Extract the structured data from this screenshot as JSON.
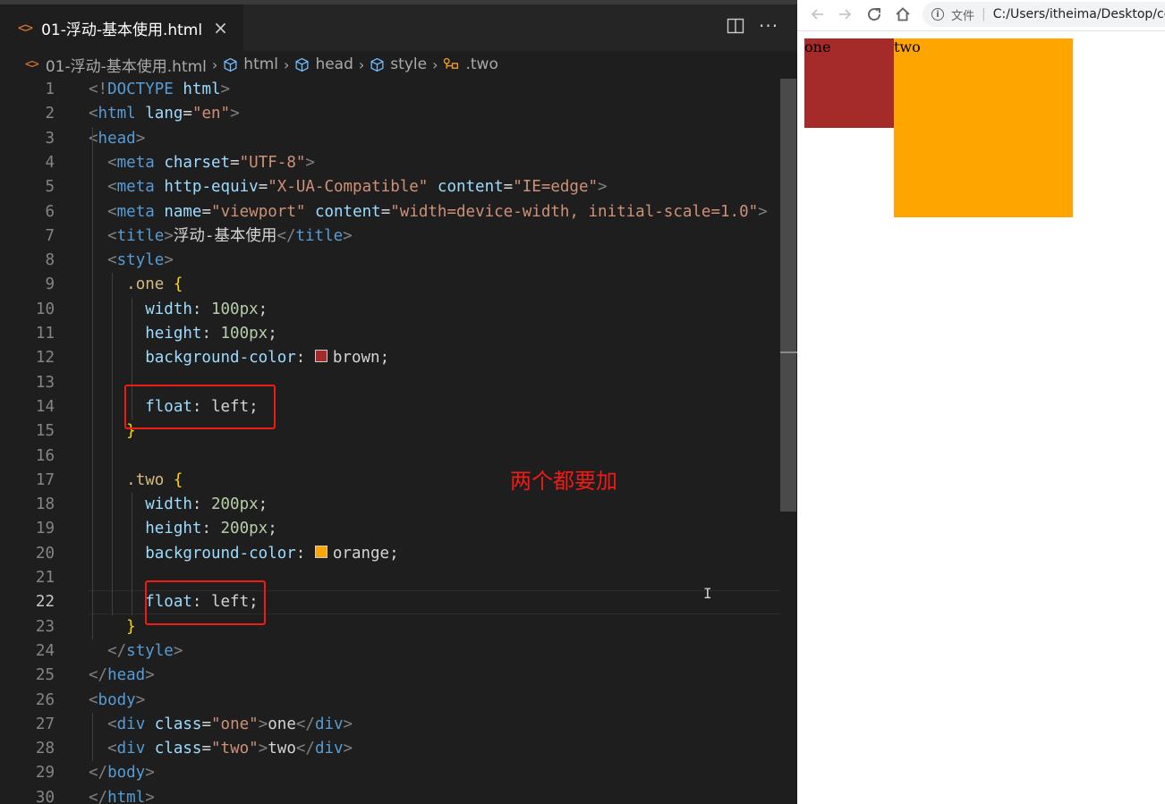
{
  "editor": {
    "tab": {
      "icon": "html-file-icon",
      "label": "01-浮动-基本使用.html",
      "close": "×"
    },
    "actions": {
      "split": "split-editor-icon",
      "more": "···"
    },
    "breadcrumb": {
      "file": "01-浮动-基本使用.html",
      "items": [
        "html",
        "head",
        "style",
        ".two"
      ]
    },
    "lines": [
      {
        "n": "1",
        "tokens": [
          [
            "punc",
            "<!"
          ],
          [
            "tag",
            "DOCTYPE"
          ],
          [
            "text",
            " "
          ],
          [
            "attr",
            "html"
          ],
          [
            "punc",
            ">"
          ]
        ]
      },
      {
        "n": "2",
        "tokens": [
          [
            "punc",
            "<"
          ],
          [
            "tag",
            "html"
          ],
          [
            "text",
            " "
          ],
          [
            "attr",
            "lang"
          ],
          [
            "text",
            "="
          ],
          [
            "str",
            "\"en\""
          ],
          [
            "punc",
            ">"
          ]
        ]
      },
      {
        "n": "3",
        "tokens": [
          [
            "punc",
            "<"
          ],
          [
            "tag",
            "head"
          ],
          [
            "punc",
            ">"
          ]
        ]
      },
      {
        "n": "4",
        "tokens": [
          [
            "text",
            "  "
          ],
          [
            "punc",
            "<"
          ],
          [
            "tag",
            "meta"
          ],
          [
            "text",
            " "
          ],
          [
            "attr",
            "charset"
          ],
          [
            "text",
            "="
          ],
          [
            "str",
            "\"UTF-8\""
          ],
          [
            "punc",
            ">"
          ]
        ]
      },
      {
        "n": "5",
        "tokens": [
          [
            "text",
            "  "
          ],
          [
            "punc",
            "<"
          ],
          [
            "tag",
            "meta"
          ],
          [
            "text",
            " "
          ],
          [
            "attr",
            "http-equiv"
          ],
          [
            "text",
            "="
          ],
          [
            "str",
            "\"X-UA-Compatible\""
          ],
          [
            "text",
            " "
          ],
          [
            "attr",
            "content"
          ],
          [
            "text",
            "="
          ],
          [
            "str",
            "\"IE=edge\""
          ],
          [
            "punc",
            ">"
          ]
        ]
      },
      {
        "n": "6",
        "tokens": [
          [
            "text",
            "  "
          ],
          [
            "punc",
            "<"
          ],
          [
            "tag",
            "meta"
          ],
          [
            "text",
            " "
          ],
          [
            "attr",
            "name"
          ],
          [
            "text",
            "="
          ],
          [
            "str",
            "\"viewport\""
          ],
          [
            "text",
            " "
          ],
          [
            "attr",
            "content"
          ],
          [
            "text",
            "="
          ],
          [
            "str",
            "\"width=device-width, initial-scale=1.0\""
          ],
          [
            "punc",
            ">"
          ]
        ]
      },
      {
        "n": "7",
        "tokens": [
          [
            "text",
            "  "
          ],
          [
            "punc",
            "<"
          ],
          [
            "tag",
            "title"
          ],
          [
            "punc",
            ">"
          ],
          [
            "text",
            "浮动-基本使用"
          ],
          [
            "punc",
            "</"
          ],
          [
            "tag",
            "title"
          ],
          [
            "punc",
            ">"
          ]
        ]
      },
      {
        "n": "8",
        "tokens": [
          [
            "text",
            "  "
          ],
          [
            "punc",
            "<"
          ],
          [
            "tag",
            "style"
          ],
          [
            "punc",
            ">"
          ]
        ]
      },
      {
        "n": "9",
        "tokens": [
          [
            "text",
            "    "
          ],
          [
            "sel",
            ".one"
          ],
          [
            "text",
            " "
          ],
          [
            "brace",
            "{"
          ]
        ]
      },
      {
        "n": "10",
        "tokens": [
          [
            "text",
            "      "
          ],
          [
            "prop",
            "width"
          ],
          [
            "text",
            ": "
          ],
          [
            "num",
            "100px"
          ],
          [
            "text",
            ";"
          ]
        ]
      },
      {
        "n": "11",
        "tokens": [
          [
            "text",
            "      "
          ],
          [
            "prop",
            "height"
          ],
          [
            "text",
            ": "
          ],
          [
            "num",
            "100px"
          ],
          [
            "text",
            ";"
          ]
        ]
      },
      {
        "n": "12",
        "tokens": [
          [
            "text",
            "      "
          ],
          [
            "prop",
            "background-color"
          ],
          [
            "text",
            ": "
          ],
          [
            "swatch",
            "#a52a2a"
          ],
          [
            "val",
            "brown"
          ],
          [
            "text",
            ";"
          ]
        ]
      },
      {
        "n": "13",
        "tokens": []
      },
      {
        "n": "14",
        "tokens": [
          [
            "text",
            "      "
          ],
          [
            "prop",
            "float"
          ],
          [
            "text",
            ": "
          ],
          [
            "val",
            "left"
          ],
          [
            "text",
            ";"
          ]
        ]
      },
      {
        "n": "15",
        "tokens": [
          [
            "text",
            "    "
          ],
          [
            "brace",
            "}"
          ]
        ]
      },
      {
        "n": "16",
        "tokens": []
      },
      {
        "n": "17",
        "tokens": [
          [
            "text",
            "    "
          ],
          [
            "sel",
            ".two"
          ],
          [
            "text",
            " "
          ],
          [
            "brace",
            "{"
          ]
        ]
      },
      {
        "n": "18",
        "tokens": [
          [
            "text",
            "      "
          ],
          [
            "prop",
            "width"
          ],
          [
            "text",
            ": "
          ],
          [
            "num",
            "200px"
          ],
          [
            "text",
            ";"
          ]
        ]
      },
      {
        "n": "19",
        "tokens": [
          [
            "text",
            "      "
          ],
          [
            "prop",
            "height"
          ],
          [
            "text",
            ": "
          ],
          [
            "num",
            "200px"
          ],
          [
            "text",
            ";"
          ]
        ]
      },
      {
        "n": "20",
        "tokens": [
          [
            "text",
            "      "
          ],
          [
            "prop",
            "background-color"
          ],
          [
            "text",
            ": "
          ],
          [
            "swatch",
            "#ffa500"
          ],
          [
            "val",
            "orange"
          ],
          [
            "text",
            ";"
          ]
        ]
      },
      {
        "n": "21",
        "tokens": []
      },
      {
        "n": "22",
        "tokens": [
          [
            "text",
            "      "
          ],
          [
            "prop",
            "float"
          ],
          [
            "text",
            ": "
          ],
          [
            "val",
            "left"
          ],
          [
            "text",
            ";"
          ]
        ]
      },
      {
        "n": "23",
        "tokens": [
          [
            "text",
            "    "
          ],
          [
            "brace",
            "}"
          ]
        ]
      },
      {
        "n": "24",
        "tokens": [
          [
            "text",
            "  "
          ],
          [
            "punc",
            "</"
          ],
          [
            "tag",
            "style"
          ],
          [
            "punc",
            ">"
          ]
        ]
      },
      {
        "n": "25",
        "tokens": [
          [
            "punc",
            "</"
          ],
          [
            "tag",
            "head"
          ],
          [
            "punc",
            ">"
          ]
        ]
      },
      {
        "n": "26",
        "tokens": [
          [
            "punc",
            "<"
          ],
          [
            "tag",
            "body"
          ],
          [
            "punc",
            ">"
          ]
        ]
      },
      {
        "n": "27",
        "tokens": [
          [
            "text",
            "  "
          ],
          [
            "punc",
            "<"
          ],
          [
            "tag",
            "div"
          ],
          [
            "text",
            " "
          ],
          [
            "attr",
            "class"
          ],
          [
            "text",
            "="
          ],
          [
            "str",
            "\"one\""
          ],
          [
            "punc",
            ">"
          ],
          [
            "text",
            "one"
          ],
          [
            "punc",
            "</"
          ],
          [
            "tag",
            "div"
          ],
          [
            "punc",
            ">"
          ]
        ]
      },
      {
        "n": "28",
        "tokens": [
          [
            "text",
            "  "
          ],
          [
            "punc",
            "<"
          ],
          [
            "tag",
            "div"
          ],
          [
            "text",
            " "
          ],
          [
            "attr",
            "class"
          ],
          [
            "text",
            "="
          ],
          [
            "str",
            "\"two\""
          ],
          [
            "punc",
            ">"
          ],
          [
            "text",
            "two"
          ],
          [
            "punc",
            "</"
          ],
          [
            "tag",
            "div"
          ],
          [
            "punc",
            ">"
          ]
        ]
      },
      {
        "n": "29",
        "tokens": [
          [
            "punc",
            "</"
          ],
          [
            "tag",
            "body"
          ],
          [
            "punc",
            ">"
          ]
        ]
      },
      {
        "n": "30",
        "tokens": [
          [
            "punc",
            "</"
          ],
          [
            "tag",
            "html"
          ],
          [
            "punc",
            ">"
          ]
        ]
      }
    ],
    "active_line": "22",
    "annotation": "两个都要加"
  },
  "browser": {
    "nav": {
      "back": "back-arrow-icon",
      "forward": "forward-arrow-icon",
      "reload": "reload-icon",
      "home": "home-icon"
    },
    "address": {
      "info_label": "文件",
      "url": "C:/Users/itheima/Desktop/cc"
    },
    "page": {
      "box_one_text": "one",
      "box_two_text": "two"
    }
  },
  "colors": {
    "brown": "#a52a2a",
    "orange": "#ffa500",
    "annotation_red": "#ef1b14"
  }
}
